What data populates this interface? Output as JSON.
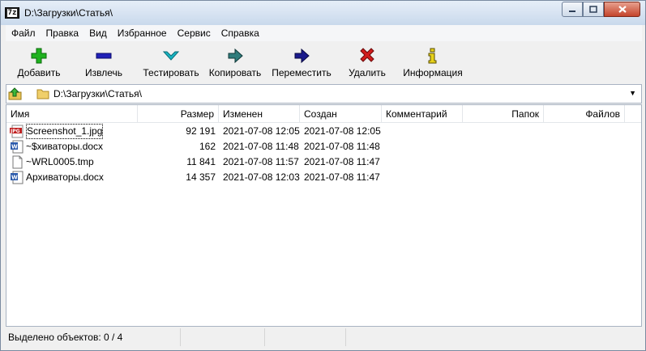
{
  "window": {
    "title": "D:\\Загрузки\\Статья\\",
    "app_icon_text": "7z"
  },
  "menu": [
    "Файл",
    "Правка",
    "Вид",
    "Избранное",
    "Сервис",
    "Справка"
  ],
  "toolbar": {
    "add": "Добавить",
    "extract": "Извлечь",
    "test": "Тестировать",
    "copy": "Копировать",
    "move": "Переместить",
    "delete": "Удалить",
    "info": "Информация"
  },
  "address": {
    "path": "D:\\Загрузки\\Статья\\"
  },
  "columns": {
    "name": "Имя",
    "size": "Размер",
    "modified": "Изменен",
    "created": "Создан",
    "comment": "Комментарий",
    "folders": "Папок",
    "files": "Файлов"
  },
  "files": [
    {
      "name": "Screenshot_1.jpg",
      "size": "92 191",
      "modified": "2021-07-08 12:05",
      "created": "2021-07-08 12:05",
      "icon": "jpg-file-icon"
    },
    {
      "name": "~$хиваторы.docx",
      "size": "162",
      "modified": "2021-07-08 11:48",
      "created": "2021-07-08 11:48",
      "icon": "word-file-icon"
    },
    {
      "name": "~WRL0005.tmp",
      "size": "11 841",
      "modified": "2021-07-08 11:57",
      "created": "2021-07-08 11:47",
      "icon": "blank-file-icon"
    },
    {
      "name": "Архиваторы.docx",
      "size": "14 357",
      "modified": "2021-07-08 12:03",
      "created": "2021-07-08 11:47",
      "icon": "word-file-icon"
    }
  ],
  "status": {
    "selected": "Выделено объектов: 0 / 4"
  },
  "colors": {
    "add_green": "#1fb21f",
    "extract_blue": "#2121b8",
    "test_cyan": "#18b6c4",
    "copy_teal": "#2f7c7c",
    "move_navy": "#1a1a8c",
    "delete_red": "#d21c1c",
    "info_yellow": "#e8d21a"
  }
}
